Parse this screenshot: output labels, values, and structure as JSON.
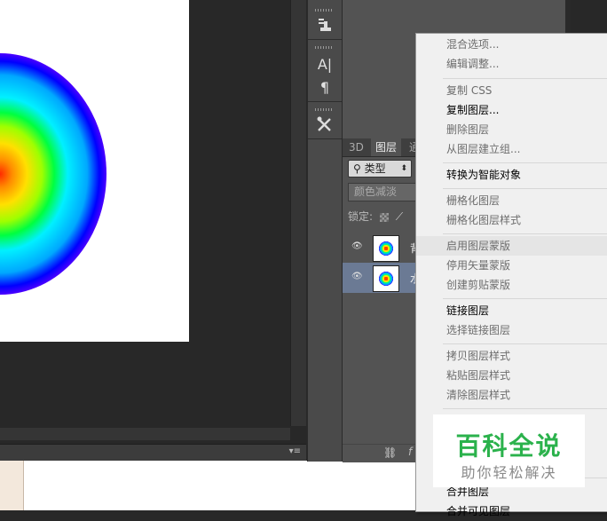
{
  "layers_panel": {
    "tabs": [
      "3D",
      "图层",
      "通"
    ],
    "filter_label": "类型",
    "filter_icon": "search-icon",
    "blend_mode": "颜色减淡",
    "lock_label": "锁定:",
    "layers": [
      {
        "name": "背"
      },
      {
        "name": "水"
      }
    ]
  },
  "tools": {
    "icons": [
      "clone-stamp-icon",
      "character-icon",
      "paragraph-icon",
      "tools-icon"
    ],
    "character_glyph": "A|",
    "paragraph_glyph": "¶"
  },
  "context_menu": {
    "items": [
      {
        "label": "混合选项...",
        "enabled": false
      },
      {
        "label": "编辑调整...",
        "enabled": false
      },
      {
        "label": "复制 CSS",
        "enabled": false
      },
      {
        "label": "复制图层...",
        "enabled": true
      },
      {
        "label": "删除图层",
        "enabled": false
      },
      {
        "label": "从图层建立组...",
        "enabled": false
      },
      {
        "label": "转换为智能对象",
        "enabled": true
      },
      {
        "label": "栅格化图层",
        "enabled": false
      },
      {
        "label": "栅格化图层样式",
        "enabled": false
      },
      {
        "label": "启用图层蒙版",
        "enabled": false,
        "highlighted": true
      },
      {
        "label": "停用矢量蒙版",
        "enabled": false
      },
      {
        "label": "创建剪贴蒙版",
        "enabled": false
      },
      {
        "label": "链接图层",
        "enabled": true
      },
      {
        "label": "选择链接图层",
        "enabled": false
      },
      {
        "label": "拷贝图层样式",
        "enabled": false
      },
      {
        "label": "粘贴图层样式",
        "enabled": false
      },
      {
        "label": "清除图层样式",
        "enabled": false
      },
      {
        "label": "合并图层",
        "enabled": true
      },
      {
        "label": "合并可见图层",
        "enabled": true
      }
    ]
  },
  "watermark": {
    "title": "百科全说",
    "subtitle": "助你轻松解决"
  },
  "colors": {
    "menu_bg": "#f0f0f0",
    "panel_bg": "#535353",
    "watermark_green": "#2bb24c"
  }
}
